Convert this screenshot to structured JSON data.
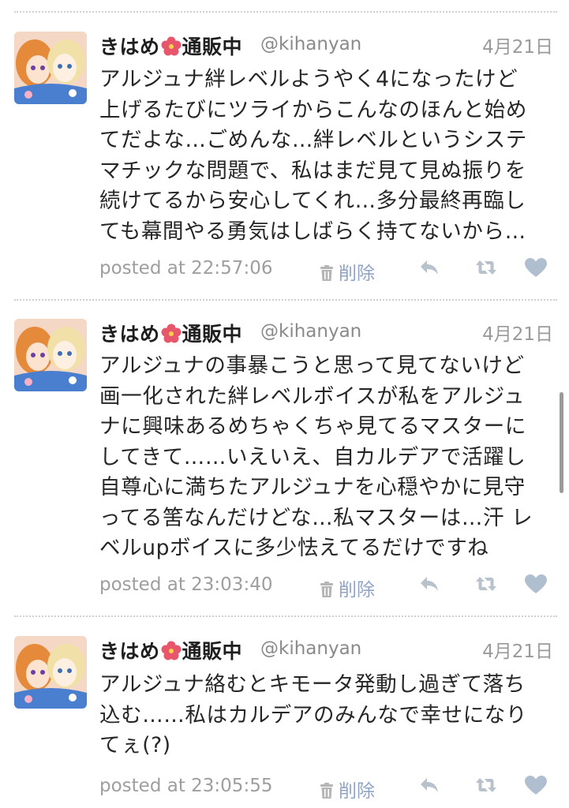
{
  "tweets": [
    {
      "display_name": "きはめ",
      "display_name_suffix": "通販中",
      "handle": "@kihanyan",
      "date": "4月21日",
      "lines": [
        "アルジュナ絆レベルようやく4になったけど",
        "上げるたびにツライからこんなのほんと始め",
        "てだよな…ごめんな…絆レベルというシステ",
        "マチックな問題で、私はまだ見て見ぬ振りを",
        "続けてるから安心してくれ…多分最終再臨し",
        "ても幕間やる勇気はしばらく持てないから…"
      ],
      "posted": "posted at 22:57:06",
      "delete_label": "削除"
    },
    {
      "display_name": "きはめ",
      "display_name_suffix": "通販中",
      "handle": "@kihanyan",
      "date": "4月21日",
      "lines": [
        "アルジュナの事暴こうと思って見てないけど",
        "画一化された絆レベルボイスが私をアルジュ",
        "ナに興味あるめちゃくちゃ見てるマスターに",
        "してきて……いえいえ、自カルデアで活躍し",
        "自尊心に満ちたアルジュナを心穏やかに見守",
        "ってる筈なんだけどな…私マスターは…汗 レ",
        "ベルupボイスに多少怯えてるだけですね"
      ],
      "posted": "posted at 23:03:40",
      "delete_label": "削除"
    },
    {
      "display_name": "きはめ",
      "display_name_suffix": "通販中",
      "handle": "@kihanyan",
      "date": "4月21日",
      "lines": [
        "アルジュナ絡むとキモータ発動し過ぎて落ち",
        "込む……私はカルデアのみんなで幸せになり",
        "てぇ(?)"
      ],
      "posted": "posted at 23:05:55",
      "delete_label": "削除"
    }
  ],
  "icons": {
    "flower": "hibiscus-icon",
    "delete": "trash-icon",
    "reply": "reply-icon",
    "retweet": "retweet-icon",
    "favorite": "heart-icon"
  },
  "colors": {
    "link": "#8fa4c9",
    "action_icon": "#b8c2cc",
    "heart": "#b0bfd0",
    "flower": "#e8566c"
  }
}
